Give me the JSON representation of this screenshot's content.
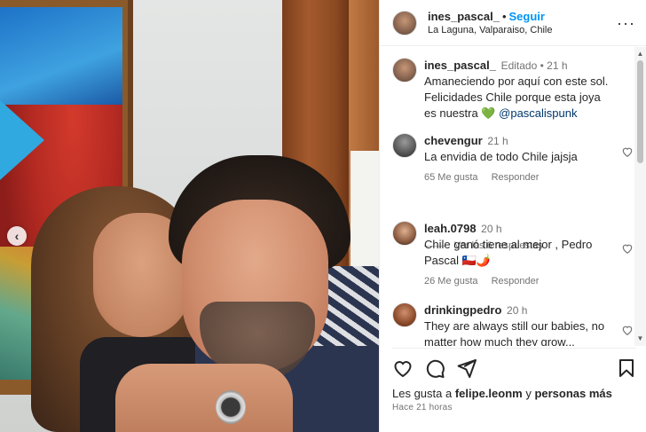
{
  "post": {
    "username": "ines_pascal_",
    "follow_label": "Seguir",
    "location": "La Laguna, Valparaiso, Chile"
  },
  "caption": {
    "username": "ines_pascal_",
    "edited": "Editado",
    "time": "21 h",
    "text": "Amaneciendo por aquí con este sol. Felicidades Chile porque esta joya es nuestra",
    "mention": "@pascalispunk"
  },
  "comments": [
    {
      "username": "chevengur",
      "time": "21 h",
      "text": "La envidia de todo Chile jajsja",
      "likes": "65 Me gusta",
      "reply": "Responder"
    },
    {
      "username": "leah.0798",
      "time": "20 h",
      "text": "Chile ganó tiene al mejor , Pedro Pascal",
      "likes": "26 Me gusta",
      "reply": "Responder"
    },
    {
      "username": "drinkingpedro",
      "time": "20 h",
      "text": "They are always still our babies, no matter how much they grow..."
    }
  ],
  "view_replies": "Ver las 6 respuestas",
  "likes_line": {
    "prefix": "Les gusta a",
    "user": "felipe.leonm",
    "conj": "y",
    "others": "personas más"
  },
  "time_ago": "Hace 21 horas",
  "colors": {
    "link": "#0095f6",
    "muted": "#737373",
    "text": "#262626"
  }
}
